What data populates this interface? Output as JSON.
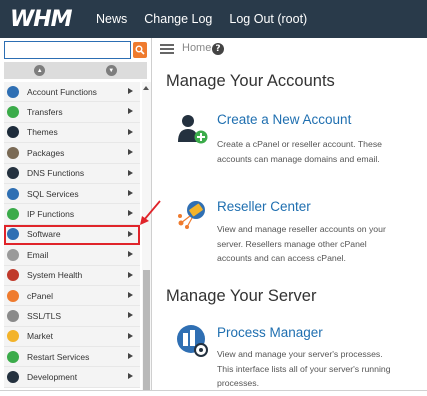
{
  "topbar": {
    "logo": "WHM",
    "nav": [
      "News",
      "Change Log",
      "Log Out (root)"
    ]
  },
  "sidebar": {
    "search": {
      "value": "",
      "placeholder": ""
    },
    "items": [
      {
        "label": "Account Functions",
        "icon": "account-functions-icon",
        "color": "#2f6fb3"
      },
      {
        "label": "Transfers",
        "icon": "transfers-icon",
        "color": "#3bab4a"
      },
      {
        "label": "Themes",
        "icon": "themes-icon",
        "color": "#1d2b3a"
      },
      {
        "label": "Packages",
        "icon": "packages-icon",
        "color": "#7a6a55"
      },
      {
        "label": "DNS Functions",
        "icon": "dns-functions-icon",
        "color": "#24313f"
      },
      {
        "label": "SQL Services",
        "icon": "sql-services-icon",
        "color": "#2f6fb3"
      },
      {
        "label": "IP Functions",
        "icon": "ip-functions-icon",
        "color": "#3bab4a"
      },
      {
        "label": "Software",
        "icon": "software-icon",
        "color": "#2f6fb3",
        "highlighted": true
      },
      {
        "label": "Email",
        "icon": "email-icon",
        "color": "#9a9a9a"
      },
      {
        "label": "System Health",
        "icon": "system-health-icon",
        "color": "#c0392b"
      },
      {
        "label": "cPanel",
        "icon": "cpanel-icon",
        "color": "#ef7b2e"
      },
      {
        "label": "SSL/TLS",
        "icon": "ssl-tls-icon",
        "color": "#8a8a8a"
      },
      {
        "label": "Market",
        "icon": "market-icon",
        "color": "#f3b32a"
      },
      {
        "label": "Restart Services",
        "icon": "restart-services-icon",
        "color": "#3bab4a"
      },
      {
        "label": "Development",
        "icon": "development-icon",
        "color": "#24313f"
      }
    ]
  },
  "breadcrumb": {
    "home": "Home"
  },
  "main": {
    "sections": [
      {
        "title": "Manage Your Accounts",
        "features": [
          {
            "title": "Create a New Account",
            "desc": [
              "Create a cPanel or reseller account. These",
              "accounts can manage domains and email."
            ]
          },
          {
            "title": "Reseller Center",
            "desc": [
              "View and manage reseller accounts on your",
              "server. Resellers manage other cPanel",
              "accounts and can access cPanel."
            ]
          }
        ]
      },
      {
        "title": "Manage Your Server",
        "features": [
          {
            "title": "Process Manager",
            "desc": [
              "View and manage your server's processes.",
              "This interface lists all of your server's running",
              "processes."
            ]
          }
        ]
      }
    ]
  },
  "colors": {
    "topbar": "#293a4a",
    "link": "#1f6fb0",
    "accent": "#ef7b2e",
    "highlight": "#e0242a"
  }
}
